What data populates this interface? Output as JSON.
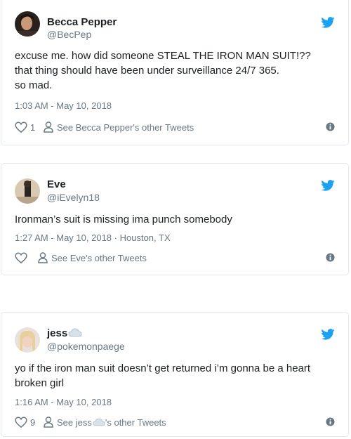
{
  "colors": {
    "text": "#1c2022",
    "muted": "#697882",
    "twitter_blue": "#1da1f2",
    "border": "#e1e8ed"
  },
  "tweets": [
    {
      "name": "Becca Pepper",
      "handle": "@BecPep",
      "text_lines": [
        "excuse me. how did someone STEAL THE IRON MAN SUIT!??",
        "that thing should have been under surveillance 24/7 365.",
        "so mad."
      ],
      "timestamp": "1:03 AM - May 10, 2018",
      "likes": "1",
      "other_tweets": "See Becca Pepper's other Tweets"
    },
    {
      "name": "Eve",
      "handle": "@iEvelyn18",
      "text_lines": [
        "Ironman’s suit is missing ima punch somebody"
      ],
      "timestamp": "1:27 AM - May 10, 2018",
      "location": "Houston, TX",
      "likes": "",
      "other_tweets": "See Eve's other Tweets"
    },
    {
      "name": "jess",
      "handle": "@pokemonpaege",
      "text_lines": [
        "yo if the iron man suit doesn’t get returned i’m gonna be a heart",
        "broken girl"
      ],
      "timestamp": "1:16 AM - May 10, 2018",
      "likes": "9",
      "other_tweets_prefix": "See jess",
      "other_tweets_suffix": "'s other Tweets"
    }
  ]
}
